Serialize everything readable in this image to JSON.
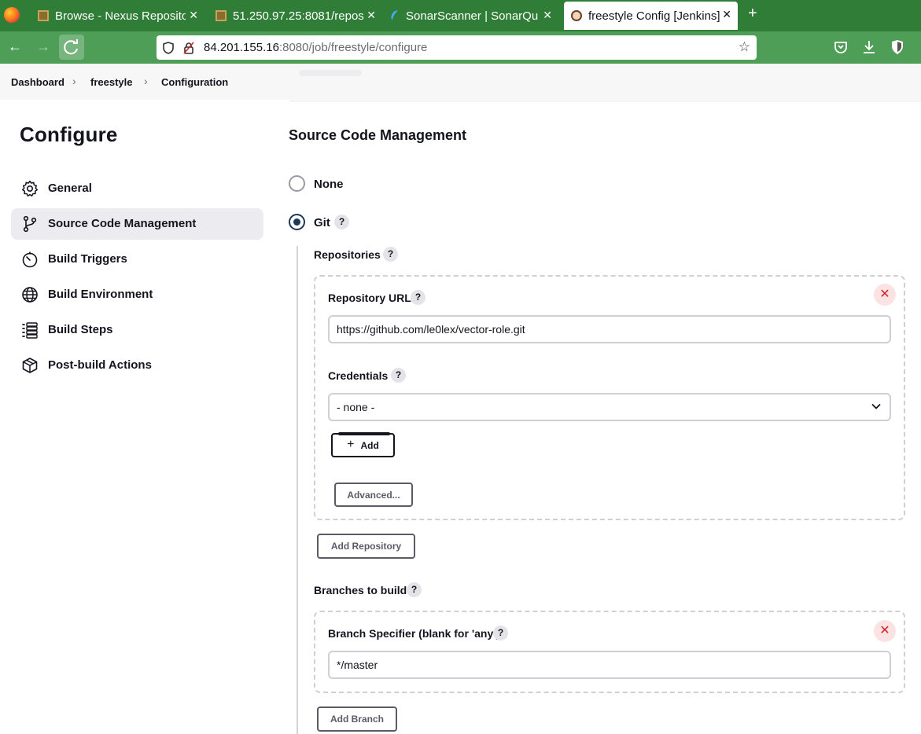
{
  "browser": {
    "tabs": [
      {
        "title": "Browse - Nexus Reposito",
        "favicon": "nexus-box-icon"
      },
      {
        "title": "51.250.97.25:8081/repos",
        "favicon": "nexus-box-icon"
      },
      {
        "title": "SonarScanner | SonarQub",
        "favicon": "sonarqube-icon"
      },
      {
        "title": "freestyle Config [Jenkins]",
        "favicon": "jenkins-icon",
        "active": true
      }
    ],
    "url_host": "84.201.155.16",
    "url_rest": ":8080/job/freestyle/configure"
  },
  "breadcrumb": [
    "Dashboard",
    "freestyle",
    "Configuration"
  ],
  "sidebar": {
    "title": "Configure",
    "items": [
      {
        "label": "General",
        "icon": "gear-icon"
      },
      {
        "label": "Source Code Management",
        "icon": "git-branch-icon",
        "active": true
      },
      {
        "label": "Build Triggers",
        "icon": "timer-icon"
      },
      {
        "label": "Build Environment",
        "icon": "globe-icon"
      },
      {
        "label": "Build Steps",
        "icon": "list-icon"
      },
      {
        "label": "Post-build Actions",
        "icon": "package-icon"
      }
    ]
  },
  "scm": {
    "title": "Source Code Management",
    "option_none": "None",
    "option_git": "Git",
    "selected": "Git",
    "repositories_label": "Repositories",
    "repository_url_label": "Repository URL",
    "repository_url_value": "https://github.com/le0lex/vector-role.git",
    "credentials_label": "Credentials",
    "credentials_value": "- none -",
    "add_label": "Add",
    "advanced_label": "Advanced...",
    "add_repository_label": "Add Repository",
    "branches_label": "Branches to build",
    "branch_specifier_label": "Branch Specifier (blank for 'any')",
    "branch_specifier_value": "*/master",
    "add_branch_label": "Add Branch",
    "help_glyph": "?",
    "delete_glyph": "✕"
  },
  "colors": {
    "browser_tabbar": "#2f7d37",
    "browser_navbar": "#4f9e57",
    "radio_selected": "#1e3757",
    "delete_red": "#d2232a"
  }
}
